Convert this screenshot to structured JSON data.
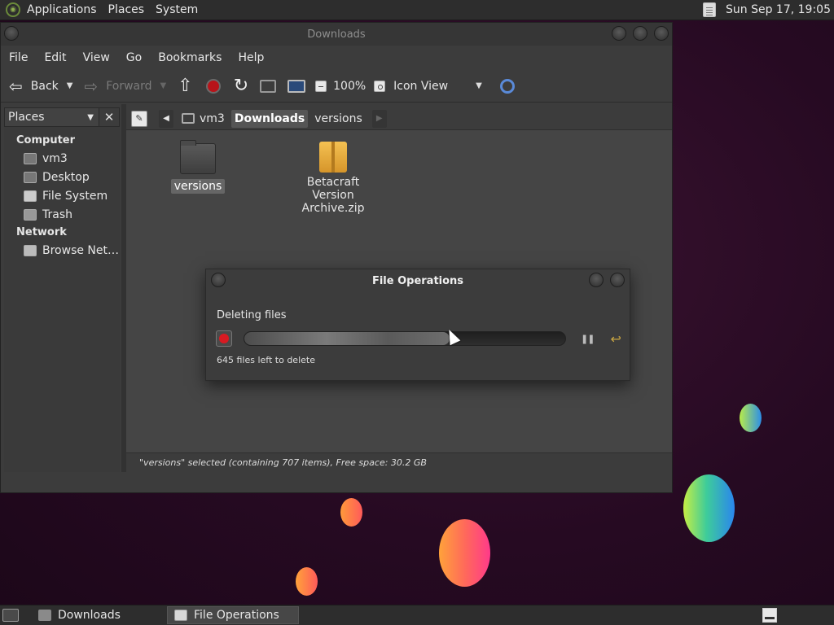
{
  "top_panel": {
    "menus": [
      "Applications",
      "Places",
      "System"
    ],
    "clock": "Sun Sep 17, 19:05"
  },
  "window": {
    "title": "Downloads",
    "menus": [
      "File",
      "Edit",
      "View",
      "Go",
      "Bookmarks",
      "Help"
    ],
    "toolbar": {
      "back": "Back",
      "forward": "Forward",
      "zoom": "100%",
      "view_mode": "Icon View"
    },
    "sidebar": {
      "selector": "Places",
      "categories": [
        {
          "label": "Computer",
          "items": [
            "vm3",
            "Desktop",
            "File System",
            "Trash"
          ]
        },
        {
          "label": "Network",
          "items": [
            "Browse Net…"
          ]
        }
      ]
    },
    "path": [
      "vm3",
      "Downloads",
      "versions"
    ],
    "files": [
      {
        "name": "versions",
        "type": "folder",
        "selected": true
      },
      {
        "name": "Betacraft Version Archive.zip",
        "type": "archive",
        "selected": false
      }
    ],
    "status": "\"versions\" selected (containing 707 items), Free space: 30.2 GB"
  },
  "dialog": {
    "title": "File Operations",
    "operation": "Deleting files",
    "progress": 0.64,
    "detail": "645 files left to delete"
  },
  "taskbar": {
    "tasks": [
      "Downloads",
      "File Operations"
    ]
  }
}
